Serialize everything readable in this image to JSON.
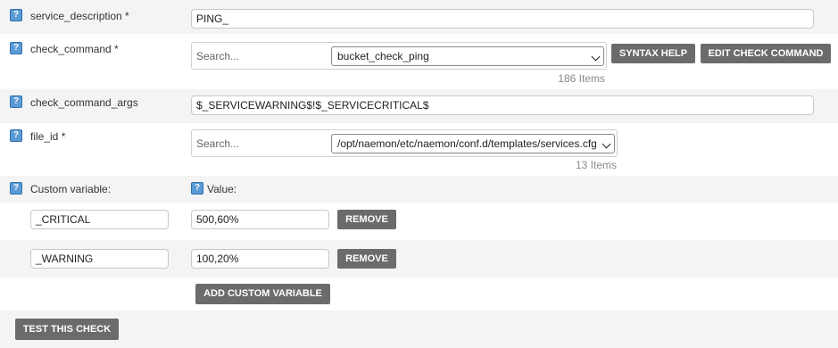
{
  "help_glyph": "?",
  "colors": {
    "button_bg": "#6b6b6b",
    "help_icon": "#5a9bd5",
    "row_shade": "#f4f4f4"
  },
  "fields": {
    "service_description": {
      "label": "service_description *",
      "value": "PING_"
    },
    "check_command": {
      "label": "check_command *",
      "search_placeholder": "Search...",
      "selected": "bucket_check_ping",
      "count": "186 Items",
      "syntax_help_label": "SYNTAX HELP",
      "edit_label": "EDIT CHECK COMMAND"
    },
    "check_command_args": {
      "label": "check_command_args",
      "value": "$_SERVICEWARNING$!$_SERVICECRITICAL$"
    },
    "file_id": {
      "label": "file_id *",
      "search_placeholder": "Search...",
      "selected": "/opt/naemon/etc/naemon/conf.d/templates/services.cfg",
      "count": "13 Items"
    }
  },
  "custom_vars": {
    "name_header": "Custom variable:",
    "value_header": "Value:",
    "remove_label": "REMOVE",
    "items": [
      {
        "name": "_CRITICAL",
        "value": "500,60%"
      },
      {
        "name": "_WARNING",
        "value": "100,20%"
      }
    ],
    "add_label": "ADD CUSTOM VARIABLE"
  },
  "test_label": "TEST THIS CHECK"
}
